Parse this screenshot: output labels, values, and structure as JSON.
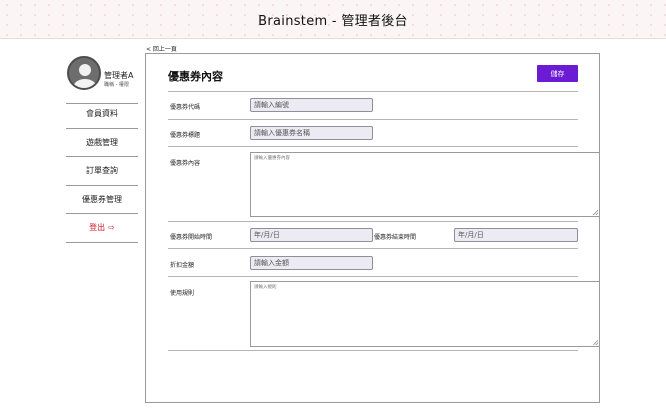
{
  "header": {
    "title": "Brainstem - 管理者後台"
  },
  "profile": {
    "name": "管理者A",
    "role": "職稱 - 權限"
  },
  "sidebar": {
    "items": [
      {
        "label": "會員資料"
      },
      {
        "label": "遊戲管理"
      },
      {
        "label": "訂單查詢"
      },
      {
        "label": "優惠券管理"
      },
      {
        "label": "登出"
      }
    ]
  },
  "back_link": "< 回上一頁",
  "panel": {
    "title": "優惠券內容",
    "save_label": "儲存",
    "fields": {
      "code": {
        "label": "優惠券代碼",
        "placeholder": "請輸入編號"
      },
      "name": {
        "label": "優惠券標題",
        "placeholder": "請輸入優惠券名稱"
      },
      "content": {
        "label": "優惠券內容",
        "placeholder": "請輸入優惠券內容"
      },
      "start": {
        "label": "優惠券開始時間",
        "placeholder": "年/月/日"
      },
      "end": {
        "label": "優惠券結束時間",
        "placeholder": "年/月/日"
      },
      "discount": {
        "label": "折扣金額",
        "placeholder": "請輸入金額"
      },
      "rules": {
        "label": "使用規則",
        "placeholder": "請輸入規則"
      }
    }
  },
  "colors": {
    "accent": "#6a1bd3",
    "logout": "#d01b2e"
  },
  "icons": {
    "avatar": "user-avatar-icon",
    "logout": "logout-icon"
  }
}
